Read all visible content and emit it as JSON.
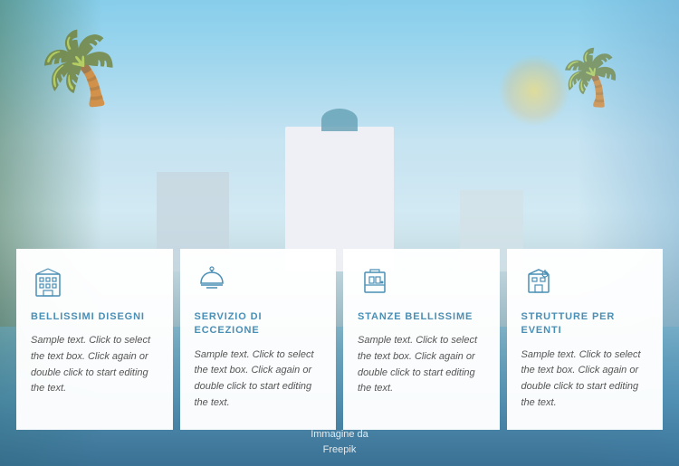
{
  "background": {
    "alt": "Hotel resort pool background"
  },
  "imageCredit": {
    "label": "Immagine da",
    "source": "Freepik"
  },
  "cards": [
    {
      "id": "card-1",
      "icon": "hotel-building-icon",
      "title": "BELLISSIMI DISEGNI",
      "text": "Sample text. Click to select the text box. Click again or double click to start editing the text."
    },
    {
      "id": "card-2",
      "icon": "concierge-bell-icon",
      "title": "SERVIZIO DI ECCEZIONE",
      "text": "Sample text. Click to select the text box. Click again or double click to start editing the text."
    },
    {
      "id": "card-3",
      "icon": "hotel-room-icon",
      "title": "STANZE BELLISSIME",
      "text": "Sample text. Click to select the text box. Click again or double click to start editing the text."
    },
    {
      "id": "card-4",
      "icon": "event-venue-icon",
      "title": "STRUTTURE PER EVENTI",
      "text": "Sample text. Click to select the text box. Click again or double click to start editing the text."
    }
  ]
}
